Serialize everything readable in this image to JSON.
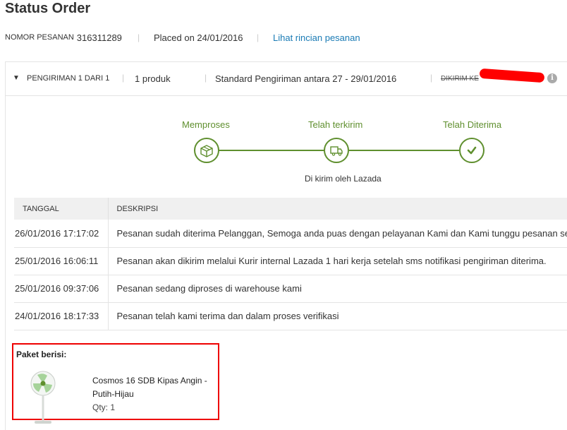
{
  "page": {
    "title": "Status Order"
  },
  "order": {
    "number_label": "NOMOR PESANAN",
    "number_value": "316311289",
    "placed": "Placed on 24/01/2016",
    "details_link": "Lihat rincian pesanan"
  },
  "shipment": {
    "label": "PENGIRIMAN 1 DARI 1",
    "products": "1 produk",
    "shipping": "Standard Pengiriman antara 27 - 29/01/2016",
    "destination": "DIKIRIM KE"
  },
  "progress": {
    "steps": [
      {
        "label": "Memproses",
        "icon": "box-icon"
      },
      {
        "label": "Telah terkirim",
        "icon": "truck-icon"
      },
      {
        "label": "Telah Diterima",
        "icon": "check-icon"
      }
    ],
    "delivered_by": "Di kirim oleh Lazada",
    "accent_color": "#5f8f2e"
  },
  "history": {
    "headers": {
      "date": "TANGGAL",
      "desc": "DESKRIPSI"
    },
    "rows": [
      {
        "date": "26/01/2016 17:17:02",
        "desc": "Pesanan sudah diterima Pelanggan, Semoga anda puas dengan pelayanan Kami dan Kami tunggu pesanan se"
      },
      {
        "date": "25/01/2016 16:06:11",
        "desc": "Pesanan akan dikirim melalui Kurir internal Lazada 1 hari kerja setelah sms notifikasi pengiriman diterima."
      },
      {
        "date": "25/01/2016 09:37:06",
        "desc": "Pesanan sedang diproses di warehouse kami"
      },
      {
        "date": "24/01/2016 18:17:33",
        "desc": "Pesanan telah kami terima dan dalam proses verifikasi"
      }
    ]
  },
  "package": {
    "title": "Paket berisi:",
    "product_name": "Cosmos 16 SDB Kipas Angin - Putih-Hijau",
    "qty": "Qty: 1",
    "image_icon": "fan-icon"
  }
}
